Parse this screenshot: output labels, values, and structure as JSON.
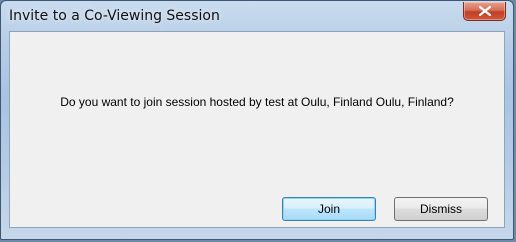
{
  "window": {
    "title": "Invite to a Co-Viewing Session",
    "close_icon": "close-icon"
  },
  "dialog": {
    "message": "Do you want to join session hosted by test at Oulu, Finland Oulu, Finland?"
  },
  "buttons": {
    "join_label": "Join",
    "dismiss_label": "Dismiss"
  }
}
